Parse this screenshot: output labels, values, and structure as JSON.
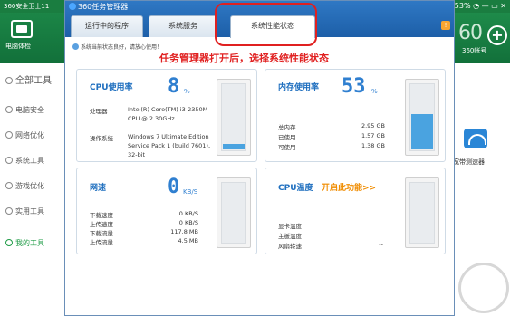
{
  "background_app": {
    "title": "360安全卫士11",
    "window_controls": "6% ▢ 53% ◔ — ▭ ✕",
    "nav_pc_checkup": "电脑体检",
    "account_label": "360帐号",
    "big_number": "60",
    "sidebar": {
      "items": [
        {
          "label": "全部工具"
        },
        {
          "label": "电脑安全"
        },
        {
          "label": "网络优化"
        },
        {
          "label": "系统工具"
        },
        {
          "label": "游戏优化"
        },
        {
          "label": "实用工具"
        },
        {
          "label": "我的工具"
        }
      ]
    },
    "right_tool_label": "宽带测速器"
  },
  "task_manager": {
    "title": "360任务管理器",
    "tabs": [
      {
        "label": "运行中的程序"
      },
      {
        "label": "系统服务"
      },
      {
        "label": "系统性能状态"
      }
    ],
    "help": "!",
    "info_text": "系统当前状态良好，请放心使用！",
    "annotation": "任务管理器打开后，选择系统性能状态",
    "cpu": {
      "title": "CPU使用率",
      "value": "8",
      "unit": "%",
      "usage_fraction": 0.08,
      "processor_label": "处理器",
      "processor_value_1": "Intel(R) Core(TM) i3-2350M",
      "processor_value_2": "CPU @ 2.30GHz",
      "os_label": "操作系统",
      "os_value_1": "Windows 7 Ultimate Edition",
      "os_value_2": "Service Pack 1 (build 7601),",
      "os_value_3": "32-bit"
    },
    "memory": {
      "title": "内存使用率",
      "value": "53",
      "unit": "%",
      "usage_fraction": 0.53,
      "rows": [
        {
          "label": "总内存",
          "value": "2.95 GB"
        },
        {
          "label": "已使用",
          "value": "1.57 GB"
        },
        {
          "label": "可使用",
          "value": "1.38 GB"
        }
      ]
    },
    "network": {
      "title": "网速",
      "value": "0",
      "unit": "KB/S",
      "rows": [
        {
          "label": "下载速度",
          "value": "0 KB/S"
        },
        {
          "label": "上传速度",
          "value": "0 KB/S"
        },
        {
          "label": "下载流量",
          "value": "117.8 MB"
        },
        {
          "label": "上传流量",
          "value": "4.5 MB"
        }
      ]
    },
    "temperature": {
      "title": "CPU温度",
      "link": "开启此功能>>",
      "rows": [
        {
          "label": "显卡温度",
          "value": "--"
        },
        {
          "label": "主板温度",
          "value": "--"
        },
        {
          "label": "风扇转速",
          "value": "--"
        }
      ]
    }
  }
}
